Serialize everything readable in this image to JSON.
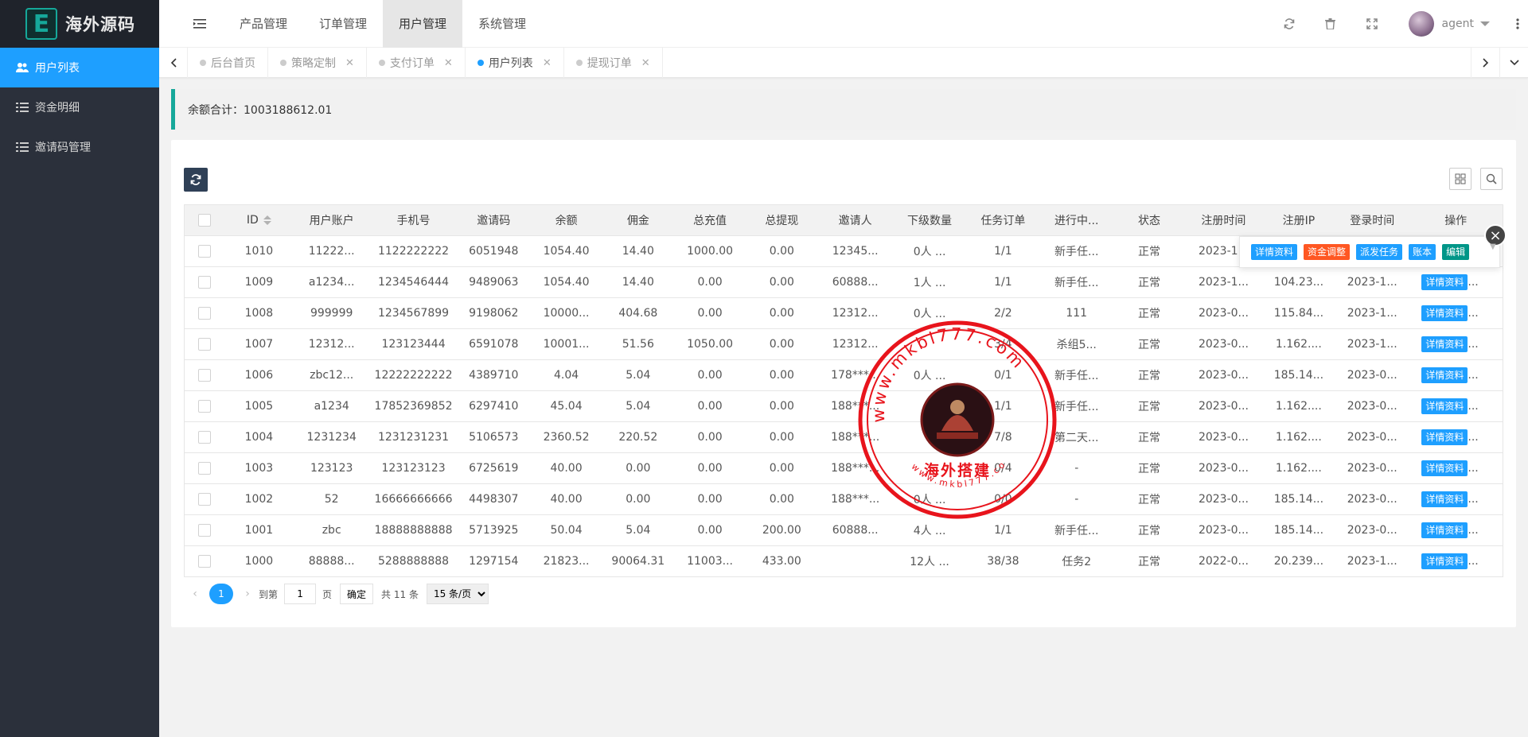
{
  "brand": {
    "logo_letter": "E",
    "name": "海外源码"
  },
  "sidebar": {
    "items": [
      {
        "label": "用户列表",
        "icon": "users-icon",
        "active": true
      },
      {
        "label": "资金明细",
        "icon": "list-icon",
        "active": false
      },
      {
        "label": "邀请码管理",
        "icon": "list-icon",
        "active": false
      }
    ]
  },
  "header": {
    "nav": [
      {
        "label": "产品管理",
        "active": false
      },
      {
        "label": "订单管理",
        "active": false
      },
      {
        "label": "用户管理",
        "active": true
      },
      {
        "label": "系统管理",
        "active": false
      }
    ],
    "username": "agent"
  },
  "tabs": [
    {
      "label": "后台首页",
      "closable": false,
      "active": false
    },
    {
      "label": "策略定制",
      "closable": true,
      "active": false
    },
    {
      "label": "支付订单",
      "closable": true,
      "active": false
    },
    {
      "label": "用户列表",
      "closable": true,
      "active": true
    },
    {
      "label": "提现订单",
      "closable": true,
      "active": false
    }
  ],
  "notice": {
    "text": "余额合计：1003188612.01"
  },
  "table": {
    "columns": [
      "ID",
      "用户账户",
      "手机号",
      "邀请码",
      "余额",
      "佣金",
      "总充值",
      "总提现",
      "邀请人",
      "下级数量",
      "任务订单",
      "进行中...",
      "状态",
      "注册时间",
      "注册IP",
      "登录时间",
      "操作"
    ],
    "rows": [
      [
        "1010",
        "11222...",
        "1122222222",
        "6051948",
        "1054.40",
        "14.40",
        "1000.00",
        "0.00",
        "12345...",
        "0人 ...",
        "1/1",
        "新手任...",
        "正常",
        "2023-1...",
        "",
        "",
        ""
      ],
      [
        "1009",
        "a1234...",
        "1234546444",
        "9489063",
        "1054.40",
        "14.40",
        "0.00",
        "0.00",
        "60888...",
        "1人 ...",
        "1/1",
        "新手任...",
        "正常",
        "2023-1...",
        "104.23...",
        "2023-1...",
        "详情资料"
      ],
      [
        "1008",
        "999999",
        "1234567899",
        "9198062",
        "10000...",
        "404.68",
        "0.00",
        "0.00",
        "12312...",
        "0人 ...",
        "2/2",
        "111",
        "正常",
        "2023-0...",
        "115.84...",
        "2023-1...",
        "详情资料"
      ],
      [
        "1007",
        "12312...",
        "123123444",
        "6591078",
        "10001...",
        "51.56",
        "1050.00",
        "0.00",
        "12312...",
        "",
        "3/4",
        "杀组5...",
        "正常",
        "2023-0...",
        "1.162....",
        "2023-1...",
        "详情资料"
      ],
      [
        "1006",
        "zbc12...",
        "12222222222",
        "4389710",
        "4.04",
        "5.04",
        "0.00",
        "0.00",
        "178***...",
        "0人 ...",
        "0/1",
        "新手任...",
        "正常",
        "2023-0...",
        "185.14...",
        "2023-0...",
        "详情资料"
      ],
      [
        "1005",
        "a1234",
        "17852369852",
        "6297410",
        "45.04",
        "5.04",
        "0.00",
        "0.00",
        "188***...",
        "",
        "1/1",
        "新手任...",
        "正常",
        "2023-0...",
        "1.162....",
        "2023-0...",
        "详情资料"
      ],
      [
        "1004",
        "1231234",
        "1231231231",
        "5106573",
        "2360.52",
        "220.52",
        "0.00",
        "0.00",
        "188***...",
        "",
        "7/8",
        "第二天...",
        "正常",
        "2023-0...",
        "1.162....",
        "2023-0...",
        "详情资料"
      ],
      [
        "1003",
        "123123",
        "123123123",
        "6725619",
        "40.00",
        "0.00",
        "0.00",
        "0.00",
        "188***...",
        "",
        "0/4",
        "-",
        "正常",
        "2023-0...",
        "1.162....",
        "2023-0...",
        "详情资料"
      ],
      [
        "1002",
        "52",
        "16666666666",
        "4498307",
        "40.00",
        "0.00",
        "0.00",
        "0.00",
        "188***...",
        "0人 ...",
        "0/0",
        "-",
        "正常",
        "2023-0...",
        "185.14...",
        "2023-0...",
        "详情资料"
      ],
      [
        "1001",
        "zbc",
        "18888888888",
        "5713925",
        "50.04",
        "5.04",
        "0.00",
        "200.00",
        "60888...",
        "4人 ...",
        "1/1",
        "新手任...",
        "正常",
        "2023-0...",
        "185.14...",
        "2023-0...",
        "详情资料"
      ],
      [
        "1000",
        "88888...",
        "5288888888",
        "1297154",
        "21823...",
        "90064.31",
        "11003...",
        "433.00",
        "",
        "12人 ...",
        "38/38",
        "任务2",
        "正常",
        "2022-0...",
        "20.239...",
        "2023-1...",
        "详情资料"
      ]
    ]
  },
  "row_actions": [
    {
      "label": "详情资料",
      "color": "#1e9fff"
    },
    {
      "label": "资金调整",
      "color": "#ff5722"
    },
    {
      "label": "派发任务",
      "color": "#1e9fff"
    },
    {
      "label": "账本",
      "color": "#1e9fff"
    },
    {
      "label": "编辑",
      "color": "#009688"
    }
  ],
  "pager": {
    "current_page": "1",
    "goto_label": "到第",
    "page_input_value": "1",
    "page_suffix": "页",
    "confirm_label": "确定",
    "total_label": "共 11 条",
    "page_size_selected": "15 条/页"
  },
  "watermark": {
    "url_text": "www.mkbl777.com",
    "caption": "海外搭建"
  },
  "colors": {
    "primary": "#1e9fff",
    "teal": "#16a89a",
    "sidebar_bg": "#2b303b",
    "danger": "#ff5722",
    "stamp_red": "#e8141c"
  }
}
